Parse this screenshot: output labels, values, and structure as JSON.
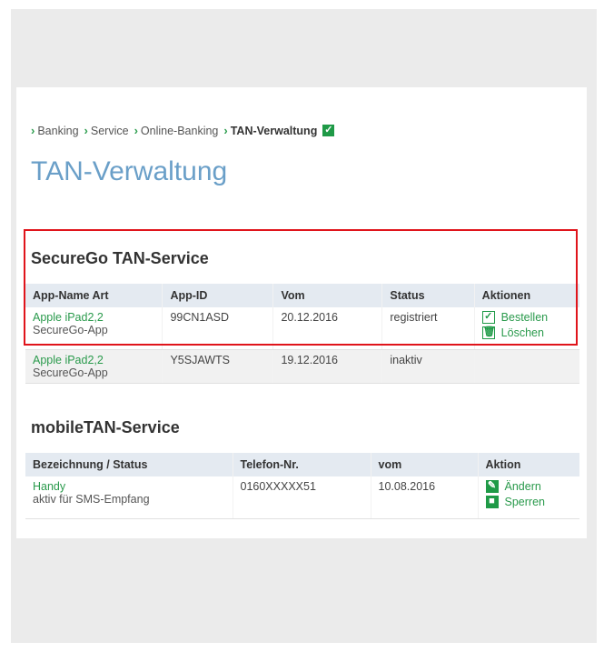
{
  "breadcrumb": {
    "items": [
      "Banking",
      "Service",
      "Online-Banking"
    ],
    "current": "TAN-Verwaltung"
  },
  "page_title": "TAN-Verwaltung",
  "securego": {
    "title": "SecureGo TAN-Service",
    "headers": [
      "App-Name Art",
      "App-ID",
      "Vom",
      "Status",
      "Aktionen"
    ],
    "rows": [
      {
        "name": "Apple iPad2,2",
        "type": "SecureGo-App",
        "app_id": "99CN1ASD",
        "vom": "20.12.2016",
        "status": "registriert",
        "actions": [
          "Bestellen",
          "Löschen"
        ]
      },
      {
        "name": "Apple iPad2,2",
        "type": "SecureGo-App",
        "app_id": "Y5SJAWTS",
        "vom": "19.12.2016",
        "status": "inaktiv",
        "actions": []
      }
    ]
  },
  "mobiletan": {
    "title": "mobileTAN-Service",
    "headers": [
      "Bezeichnung / Status",
      "Telefon-Nr.",
      "vom",
      "Aktion"
    ],
    "rows": [
      {
        "name": "Handy",
        "status": "aktiv für SMS-Empfang",
        "phone": "0160XXXXX51",
        "vom": "10.08.2016",
        "actions": [
          "Ändern",
          "Sperren"
        ]
      }
    ]
  },
  "colors": {
    "accent_green": "#2a9a4c",
    "title_blue": "#6a9fc8",
    "highlight_red": "#e0141b"
  }
}
